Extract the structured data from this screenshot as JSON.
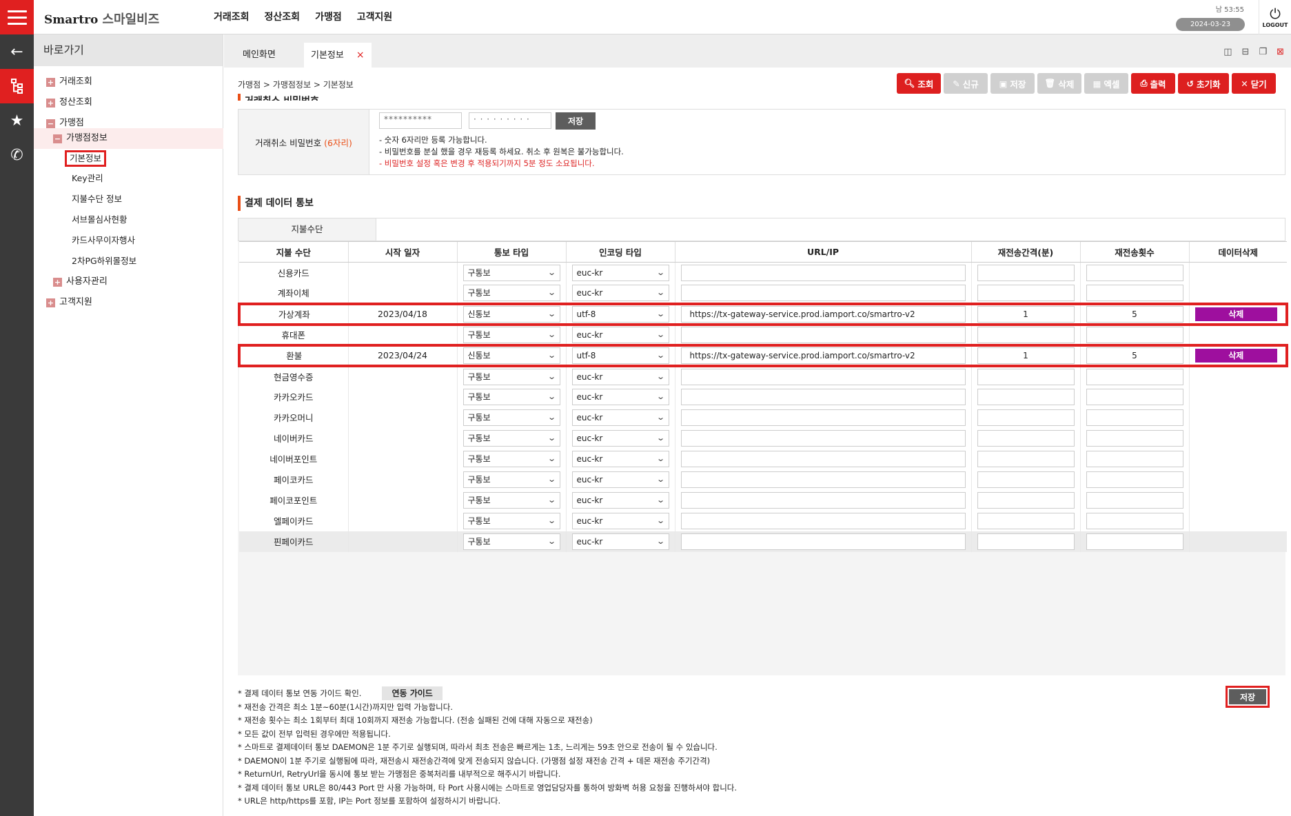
{
  "header": {
    "brand": "Smartro",
    "brand_kr": "스마일비즈",
    "nav": [
      "거래조회",
      "정산조회",
      "가맹점",
      "고객지원"
    ],
    "clock": "남 53:55",
    "date": "2024-03-23",
    "logout": "LOGOUT"
  },
  "rail": {
    "icons": [
      "back-arrow-icon",
      "sitemap-icon",
      "star-icon",
      "phone-icon"
    ]
  },
  "sidebar": {
    "title": "바로가기",
    "items": [
      {
        "label": "거래조회",
        "state": "plus"
      },
      {
        "label": "정산조회",
        "state": "plus"
      },
      {
        "label": "가맹점",
        "state": "minus"
      },
      {
        "label": "가맹점정보",
        "state": "minus"
      },
      {
        "label": "기본정보"
      },
      {
        "label": "Key관리"
      },
      {
        "label": "지불수단 정보"
      },
      {
        "label": "서브몰심사현황"
      },
      {
        "label": "카드사무이자행사"
      },
      {
        "label": "2차PG하위몰정보"
      },
      {
        "label": "사용자관리",
        "state": "plus"
      },
      {
        "label": "고객지원",
        "state": "plus"
      }
    ]
  },
  "tabs": {
    "main": "메인화면",
    "basic": "기본정보",
    "close": "×"
  },
  "breadcrumb": "가맹점 > 가맹점정보 > 기본정보",
  "actions": {
    "search": "조회",
    "new": "신규",
    "save": "저장",
    "delete": "삭제",
    "excel": "엑셀",
    "print": "출력",
    "reset": "초기화",
    "close": "닫기"
  },
  "password": {
    "section_title": "거래취소 비밀번호",
    "label": "거래취소 비밀번호",
    "label_req": "(6자리)",
    "value1": "**********",
    "value2": "· · · · · · · · ·",
    "save": "저장",
    "note1": "- 숫자 6자리만 등록 가능합니다.",
    "note2": "- 비밀번호를 분실 했을 경우 재등록 하세요. 취소 후 원복은 불가능합니다.",
    "note3": "- 비밀번호 설정 혹은 변경 후 적용되기까지 5분 정도 소요됩니다."
  },
  "notify": {
    "title": "결제 데이터 통보",
    "method_filter_label": "지불수단",
    "columns": [
      "지불 수단",
      "시작 일자",
      "통보 타입",
      "인코딩 타입",
      "URL/IP",
      "재전송간격(분)",
      "재전송횟수",
      "데이터삭제"
    ],
    "rows": [
      {
        "method": "신용카드",
        "start": "",
        "type": "구통보",
        "encoding": "euc-kr",
        "url": "",
        "interval": "",
        "count": "",
        "delete": ""
      },
      {
        "method": "계좌이체",
        "start": "",
        "type": "구통보",
        "encoding": "euc-kr",
        "url": "",
        "interval": "",
        "count": "",
        "delete": ""
      },
      {
        "method": "가상계좌",
        "start": "2023/04/18",
        "type": "신통보",
        "encoding": "utf-8",
        "url": "https://tx-gateway-service.prod.iamport.co/smartro-v2",
        "interval": "1",
        "count": "5",
        "delete": "삭제"
      },
      {
        "method": "휴대폰",
        "start": "",
        "type": "구통보",
        "encoding": "euc-kr",
        "url": "",
        "interval": "",
        "count": "",
        "delete": ""
      },
      {
        "method": "환불",
        "start": "2023/04/24",
        "type": "신통보",
        "encoding": "utf-8",
        "url": "https://tx-gateway-service.prod.iamport.co/smartro-v2",
        "interval": "1",
        "count": "5",
        "delete": "삭제"
      },
      {
        "method": "현금영수증",
        "start": "",
        "type": "구통보",
        "encoding": "euc-kr",
        "url": "",
        "interval": "",
        "count": "",
        "delete": ""
      },
      {
        "method": "카카오카드",
        "start": "",
        "type": "구통보",
        "encoding": "euc-kr",
        "url": "",
        "interval": "",
        "count": "",
        "delete": ""
      },
      {
        "method": "카카오머니",
        "start": "",
        "type": "구통보",
        "encoding": "euc-kr",
        "url": "",
        "interval": "",
        "count": "",
        "delete": ""
      },
      {
        "method": "네이버카드",
        "start": "",
        "type": "구통보",
        "encoding": "euc-kr",
        "url": "",
        "interval": "",
        "count": "",
        "delete": ""
      },
      {
        "method": "네이버포인트",
        "start": "",
        "type": "구통보",
        "encoding": "euc-kr",
        "url": "",
        "interval": "",
        "count": "",
        "delete": ""
      },
      {
        "method": "페이코카드",
        "start": "",
        "type": "구통보",
        "encoding": "euc-kr",
        "url": "",
        "interval": "",
        "count": "",
        "delete": ""
      },
      {
        "method": "페이코포인트",
        "start": "",
        "type": "구통보",
        "encoding": "euc-kr",
        "url": "",
        "interval": "",
        "count": "",
        "delete": ""
      },
      {
        "method": "엘페이카드",
        "start": "",
        "type": "구통보",
        "encoding": "euc-kr",
        "url": "",
        "interval": "",
        "count": "",
        "delete": ""
      },
      {
        "method": "핀페이카드",
        "start": "",
        "type": "구통보",
        "encoding": "euc-kr",
        "url": "",
        "interval": "",
        "count": "",
        "delete": ""
      }
    ]
  },
  "footnotes": {
    "guide_text": "* 결제 데이터 통보 연동 가이드 확인.",
    "guide_button": "연동 가이드",
    "lines": [
      "* 재전송 간격은 최소 1분~60분(1시간)까지만 입력 가능합니다.",
      "* 재전송 횟수는 최소 1회부터 최대 10회까지 재전송 가능합니다. (전송 실패된 건에 대해 자동으로 재전송)",
      "* 모든 값이 전부 입력된 경우에만 적용됩니다.",
      "* 스마트로 결제데이터 통보 DAEMON은 1분 주기로 실행되며, 따라서 최초 전송은 빠르게는 1초, 느리게는 59초 안으로 전송이 될 수 있습니다.",
      "* DAEMON이 1분 주기로 실행됨에 따라, 재전송시 재전송간격에 맞게 전송되지 않습니다. (가맹점 설정 재전송 간격 + 데몬 재전송 주기간격)",
      "* ReturnUrl, RetryUrl을 동시에 통보 받는 가맹점은 중복처리를 내부적으로 해주시기 바랍니다.",
      "* 결제 데이터 통보 URL은 80/443 Port 만 사용 가능하며, 타 Port 사용시에는 스마트로 영업담당자를 통하여 방화벽 허용 요청을 진행하셔야 합니다.",
      "* URL은 http/https를 포함, IP는 Port 정보를 포함하여 설정하시기 바랍니다."
    ],
    "save": "저장"
  },
  "colors": {
    "accent_red": "#e02020",
    "delete_purple": "#9e0f9e",
    "rail_dark": "#3a3a3a"
  }
}
